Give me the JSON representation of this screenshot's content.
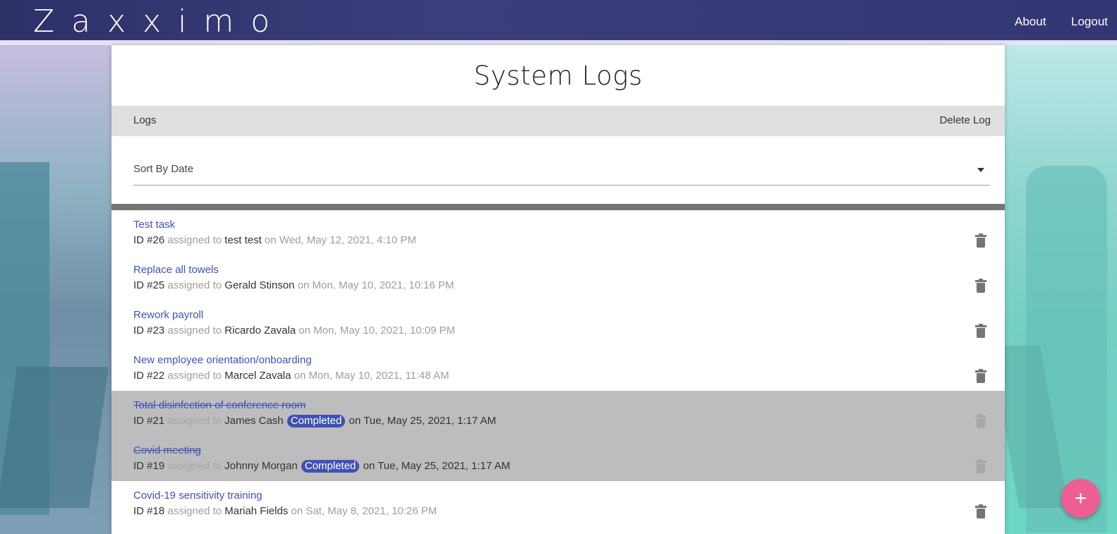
{
  "brand": "Zaxximo",
  "nav": {
    "about": "About",
    "logout": "Logout"
  },
  "page_title": "System Logs",
  "tabs": {
    "logs": "Logs",
    "delete": "Delete Log"
  },
  "sort": {
    "label": "Sort By Date"
  },
  "logs": [
    {
      "title": "Test task",
      "id": "ID #26",
      "assigned": "assigned to",
      "who": "test test",
      "badge": "",
      "when": "on Wed, May 12, 2021, 4:10 PM",
      "completed": false
    },
    {
      "title": "Replace all towels",
      "id": "ID #25",
      "assigned": "assigned to",
      "who": "Gerald Stinson",
      "badge": "",
      "when": "on Mon, May 10, 2021, 10:16 PM",
      "completed": false
    },
    {
      "title": "Rework payroll",
      "id": "ID #23",
      "assigned": "assigned to",
      "who": "Ricardo Zavala",
      "badge": "",
      "when": "on Mon, May 10, 2021, 10:09 PM",
      "completed": false
    },
    {
      "title": "New employee orientation/onboarding",
      "id": "ID #22",
      "assigned": "assigned to",
      "who": "Marcel Zavala",
      "badge": "",
      "when": "on Mon, May 10, 2021, 11:48 AM",
      "completed": false
    },
    {
      "title": "Total disinfection of conference room",
      "id": "ID #21",
      "assigned": "assigned to",
      "who": "James Cash",
      "badge": "Completed",
      "when": "on Tue, May 25, 2021, 1:17 AM",
      "completed": true
    },
    {
      "title": "Covid meeting",
      "id": "ID #19",
      "assigned": "assigned to",
      "who": "Johnny Morgan",
      "badge": "Completed",
      "when": "on Tue, May 25, 2021, 1:17 AM",
      "completed": true
    },
    {
      "title": "Covid-19 sensitivity training",
      "id": "ID #18",
      "assigned": "assigned to",
      "who": "Mariah Fields",
      "badge": "",
      "when": "on Sat, May 8, 2021, 10:26 PM",
      "completed": false
    }
  ],
  "fab": {
    "label": "+"
  },
  "icons": {
    "delete": "trash-icon",
    "dropdown": "caret-down-icon",
    "add": "plus-icon"
  },
  "colors": {
    "primary": "#3f51b5",
    "navbar": "#333672",
    "fab": "#ef5e92",
    "completed_row": "#bdbdbd"
  }
}
